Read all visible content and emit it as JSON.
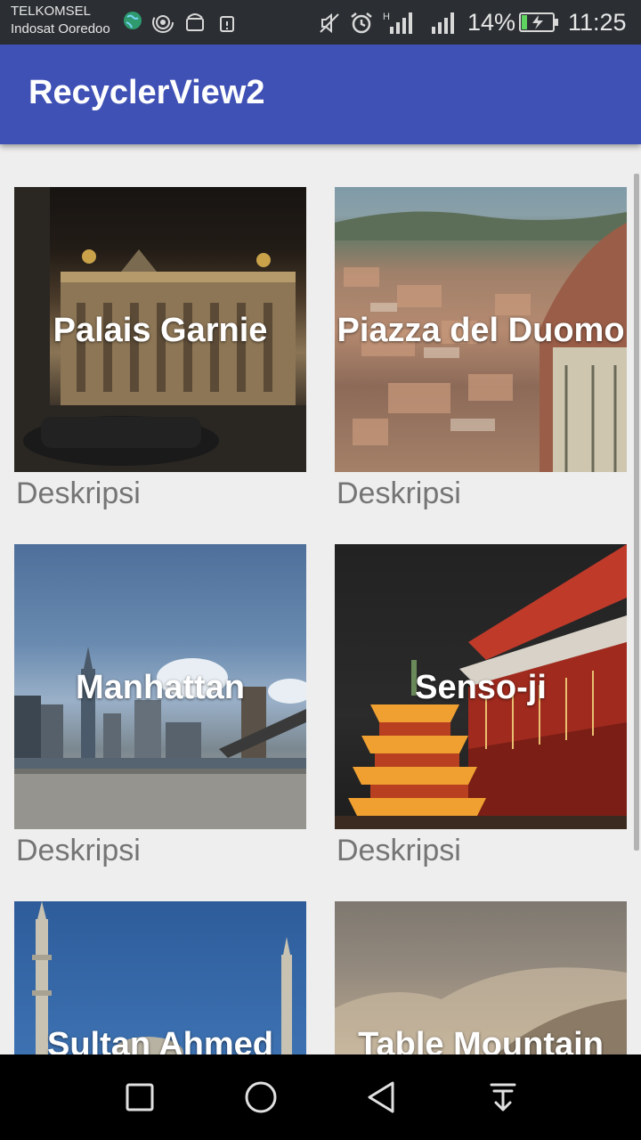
{
  "status_bar": {
    "carrier1": "TELKOMSEL",
    "carrier2": "Indosat Ooredoo",
    "network": "H",
    "battery": "14%",
    "time": "11:25",
    "icons": [
      "globe-icon",
      "hotspot-icon",
      "android-icon",
      "debug-icon",
      "mute-icon",
      "alarm-icon",
      "signal-icon",
      "signal-icon",
      "battery-charging-icon"
    ]
  },
  "app_bar": {
    "title": "RecyclerView2"
  },
  "grid": {
    "items": [
      {
        "title": "Palais Garnie",
        "description": "Deskripsi"
      },
      {
        "title": "Piazza del Duomo",
        "description": "Deskripsi"
      },
      {
        "title": "Manhattan",
        "description": "Deskripsi"
      },
      {
        "title": "Senso-ji",
        "description": "Deskripsi"
      },
      {
        "title": "Sultan Ahmed",
        "description": ""
      },
      {
        "title": "Table Mountain",
        "description": ""
      }
    ]
  },
  "nav_bar": {
    "buttons": [
      "recents-button",
      "home-button",
      "back-button",
      "notification-pull-button"
    ]
  }
}
